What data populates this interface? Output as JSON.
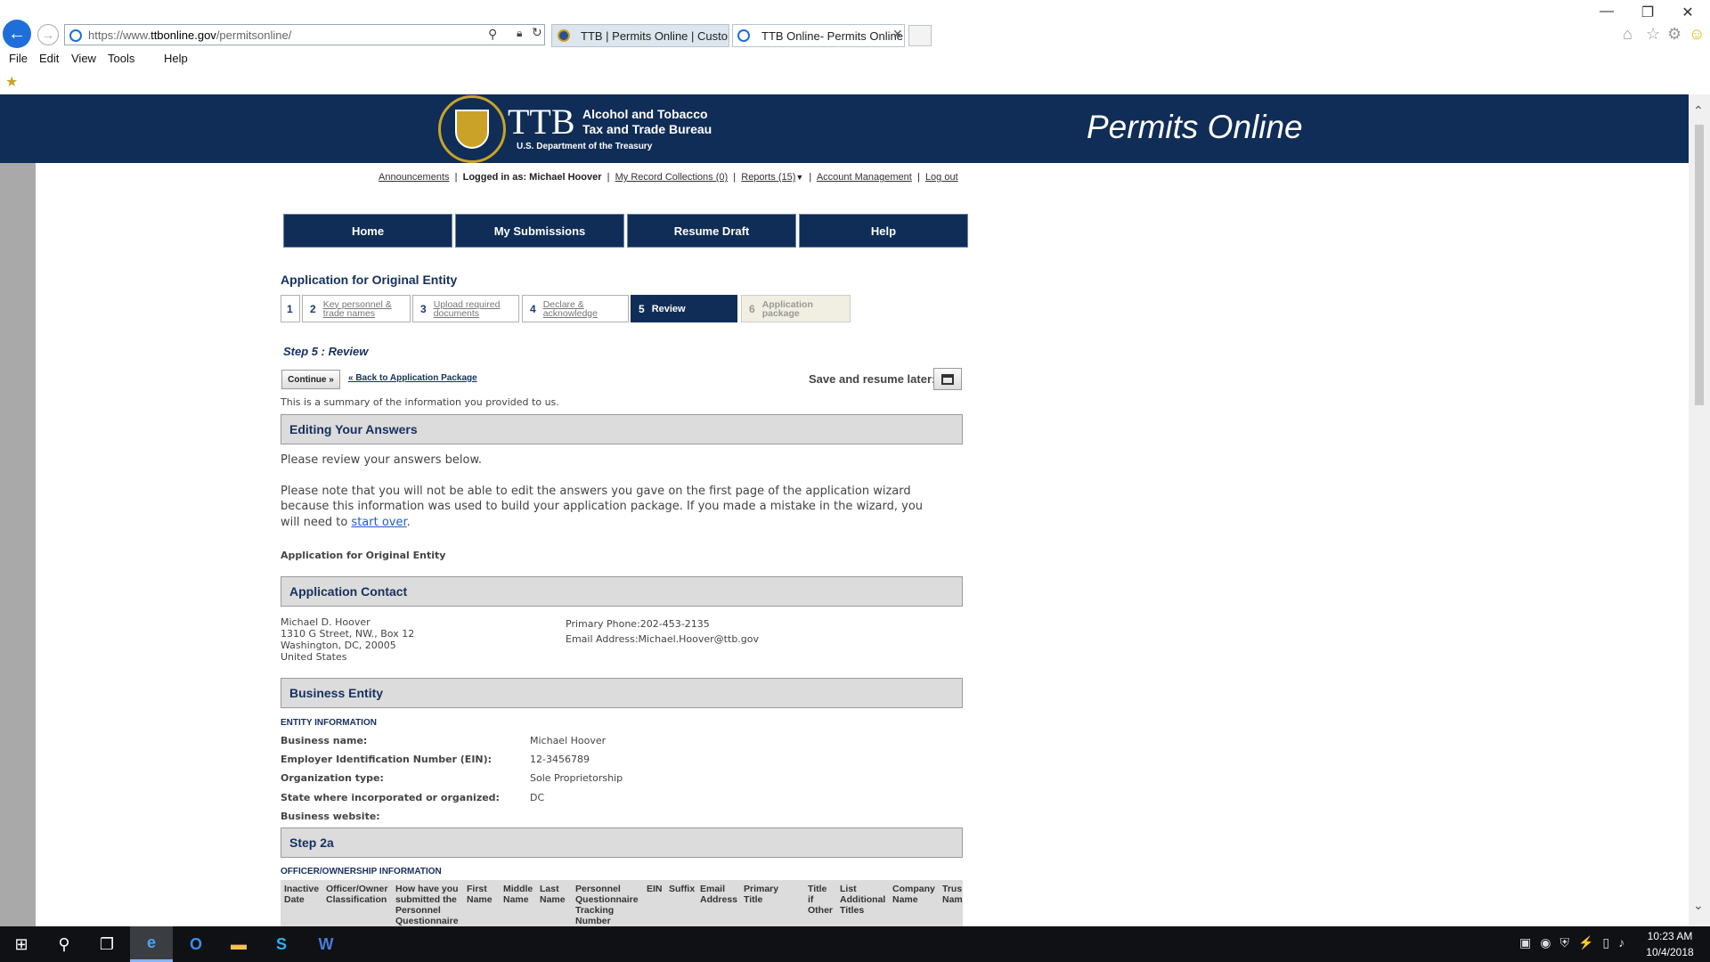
{
  "browser": {
    "url_base": "https://www.",
    "url_host": "ttbonline.gov",
    "url_path": "/permitsonline/",
    "tabs": [
      {
        "label": "TTB | Permits Online | Custom..."
      },
      {
        "label": "TTB Online- Permits Online..."
      }
    ],
    "menu": [
      "File",
      "Edit",
      "View",
      "Tools",
      "Help"
    ]
  },
  "header": {
    "ttb": "TTB",
    "agency_line1": "Alcohol and Tobacco",
    "agency_line2": "Tax and Trade Bureau",
    "dept": "U.S. Department of the Treasury",
    "app_title": "Permits Online"
  },
  "userbar": {
    "announcements": "Announcements",
    "logged_in_label": "Logged in as:",
    "user_name": "Michael Hoover",
    "record_collections": "My Record Collections (0)",
    "reports": "Reports (15)",
    "account_management": "Account Management",
    "logout": "Log out"
  },
  "nav": [
    "Home",
    "My Submissions",
    "Resume Draft",
    "Help"
  ],
  "page": {
    "title": "Application for Original Entity",
    "steps": [
      {
        "num": "1",
        "l1": "",
        "l2": ""
      },
      {
        "num": "2",
        "l1": "Key personnel &",
        "l2": "trade names"
      },
      {
        "num": "3",
        "l1": "Upload required",
        "l2": "documents"
      },
      {
        "num": "4",
        "l1": "Declare &",
        "l2": "acknowledge"
      },
      {
        "num": "5",
        "l1": "Review",
        "l2": ""
      },
      {
        "num": "6",
        "l1": "Application",
        "l2": "package"
      }
    ],
    "step_heading": "Step 5 : Review",
    "continue": "Continue »",
    "back_link": "« Back to Application Package",
    "save_resume": "Save and resume later:",
    "summary": "This is a summary of the information you provided to us.",
    "editing_heading": "Editing Your Answers",
    "review_text": "Please review your answers below.",
    "note_line1": "Please note that you will not be able to edit the answers you gave on the first page of the application wizard",
    "note_line2": "because this information was used to build your application package. If you made a mistake in the wizard, you",
    "note_line3_pre": "will need to",
    "start_over": "start over",
    "note_line3_post": ".",
    "app_name": "Application for Original Entity"
  },
  "contact": {
    "heading": "Application Contact",
    "name": "Michael D. Hoover",
    "street": "1310 G Street, NW., Box 12",
    "city": "Washington, DC, 20005",
    "country": "United States",
    "phone": "Primary Phone:202-453-2135",
    "email": "Email Address:Michael.Hoover@ttb.gov"
  },
  "entity": {
    "heading": "Business Entity",
    "subheading": "ENTITY INFORMATION",
    "fields": [
      {
        "label": "Business name:",
        "value": "Michael Hoover"
      },
      {
        "label": "Employer Identification Number (EIN):",
        "value": "12-3456789"
      },
      {
        "label": "Organization type:",
        "value": "Sole Proprietorship"
      },
      {
        "label": "State where incorporated or organized:",
        "value": "DC"
      },
      {
        "label": "Business website:",
        "value": ""
      }
    ]
  },
  "step2a": {
    "heading": "Step 2a",
    "subheading": "OFFICER/OWNERSHIP INFORMATION",
    "columns": [
      "Inactive\nDate",
      "Officer/Owner\nClassification",
      "How have you\nsubmitted the\nPersonnel\nQuestionnaire",
      "First\nName",
      "Middle\nName",
      "Last\nName",
      "Personnel\nQuestionnaire\nTracking\nNumber",
      "EIN",
      "Suffix",
      "Email\nAddress",
      "Primary\nTitle",
      "Title\nif\nOther",
      "List\nAdditional\nTitles",
      "Company\nName",
      "Trus\nNam"
    ]
  },
  "taskbar": {
    "time": "10:23 AM",
    "date": "10/4/2018"
  }
}
